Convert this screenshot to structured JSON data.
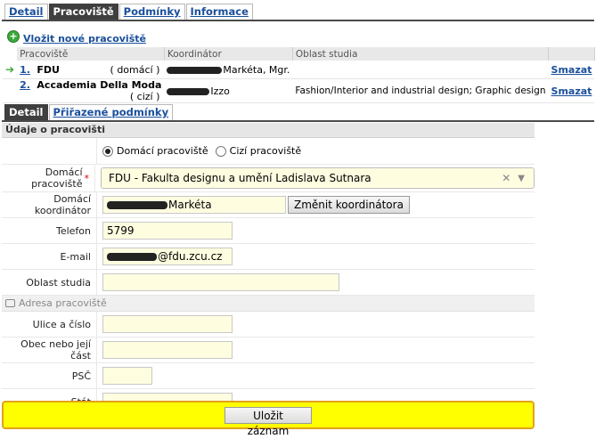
{
  "top_tabs": [
    "Detail",
    "Pracoviště",
    "Podmínky",
    "Informace"
  ],
  "top_tab_active": 1,
  "add_link": "Vložit nové pracoviště",
  "list": {
    "headers": [
      "Pracoviště",
      "Koordinátor",
      "Oblast studia",
      ""
    ],
    "rows": [
      {
        "num": "1.",
        "name": "FDU",
        "type": "( domácí )",
        "coordinator": "Markéta, Mgr.",
        "area": "",
        "action": "Smazat"
      },
      {
        "num": "2.",
        "name": "Accademia Della Moda",
        "type": "( cizí )",
        "coordinator": "Izzo",
        "area": "Fashion/Interior and industrial design; Graphic design",
        "action": "Smazat"
      }
    ]
  },
  "sub_tabs": [
    "Detail",
    "Přiřazené podmínky"
  ],
  "form": {
    "section_title": "Údaje o pracovišti",
    "radio_home": "Domácí pracoviště",
    "radio_foreign": "Cizí pracoviště",
    "home_label": "Domácí pracoviště",
    "home_value": "FDU - Fakulta designu a umění Ladislava Sutnara",
    "coord_label": "Domácí koordinátor",
    "coord_value": "Markéta",
    "coord_button": "Změnit koordinátora",
    "phone_label": "Telefon",
    "phone_value": "5799",
    "email_label": "E-mail",
    "email_value": "@fdu.zcu.cz",
    "area_label": "Oblast studia",
    "area_value": "",
    "address_title": "Adresa pracoviště",
    "street_label": "Ulice a číslo",
    "city_label": "Obec nebo její část",
    "zip_label": "PSČ",
    "country_label": "Stát",
    "save_button": "Uložit záznam"
  }
}
